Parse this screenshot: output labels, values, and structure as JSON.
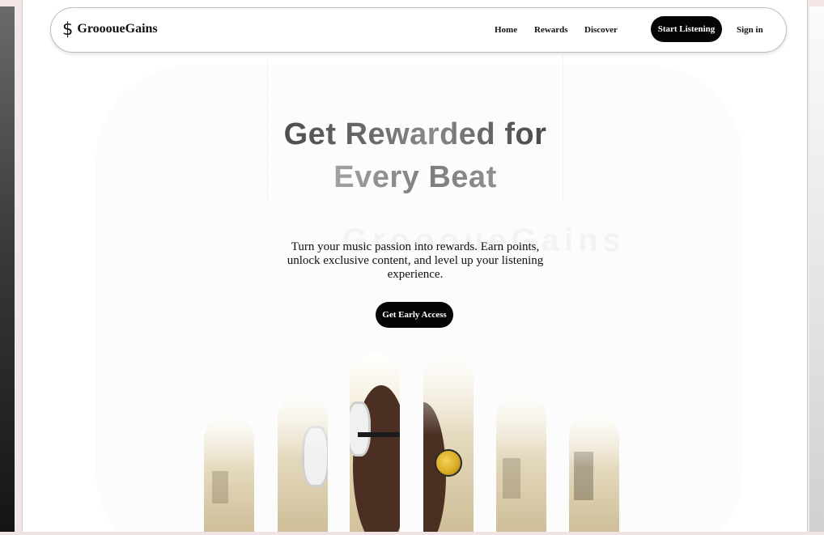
{
  "brand": {
    "name": "GroooueGains",
    "icon": "dollar-icon"
  },
  "nav": {
    "links": [
      {
        "label": "Home"
      },
      {
        "label": "Rewards"
      },
      {
        "label": "Discover"
      }
    ],
    "cta_label": "Start Listening",
    "signin_label": "Sign in"
  },
  "hero": {
    "title_line1": "Get Rewarded for",
    "title_line2": "Every Beat",
    "subtitle": "Turn your music passion into rewards. Earn points, unlock exclusive content, and level up your listening experience.",
    "cta_label": "Get Early Access"
  },
  "colors": {
    "accent": "#050505",
    "background": "#ffffff"
  }
}
